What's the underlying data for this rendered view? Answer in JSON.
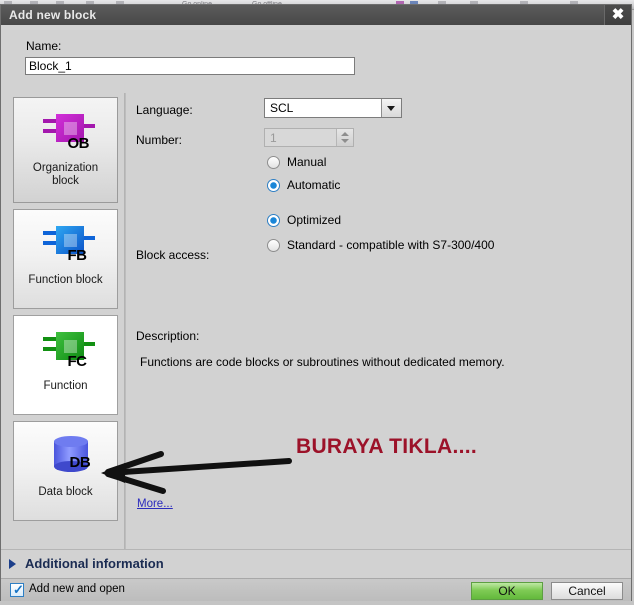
{
  "app_background": {
    "toolbar_hints": [
      "Go online",
      "Go offline"
    ]
  },
  "dialog": {
    "title": "Add new block",
    "close_icon": "close-icon",
    "name": {
      "label": "Name:",
      "value": "Block_1",
      "placeholder": "Block_1"
    },
    "block_types": [
      {
        "id": "ob",
        "label_line1": "Organization",
        "label_line2": "block",
        "glyph_text": "OB",
        "color": "#a318ad",
        "selected": true
      },
      {
        "id": "fb",
        "label_line1": "Function block",
        "label_line2": "",
        "glyph_text": "FB",
        "color": "#0e64d8",
        "selected": false
      },
      {
        "id": "fc",
        "label_line1": "Function",
        "label_line2": "",
        "glyph_text": "FC",
        "color": "#129012",
        "selected": false
      },
      {
        "id": "db",
        "label_line1": "Data block",
        "label_line2": "",
        "glyph_text": "DB",
        "color": "#4a55dd",
        "selected": false
      }
    ],
    "form": {
      "language_label": "Language:",
      "language_value": "SCL",
      "language_options": [
        "SCL"
      ],
      "number_label": "Number:",
      "number_value": "1",
      "number_enabled": false,
      "numbering_options": [
        {
          "label": "Manual",
          "checked": false
        },
        {
          "label": "Automatic",
          "checked": true
        }
      ],
      "block_access_label": "Block access:",
      "block_access_options": [
        {
          "label": "Optimized",
          "checked": true
        },
        {
          "label": "Standard - compatible with S7-300/400",
          "checked": false
        }
      ],
      "description_label": "Description:",
      "description_text": "Functions are code blocks or subroutines without dedicated memory.",
      "more_link": "More..."
    },
    "annotation": {
      "text": "BURAYA TIKLA....",
      "color": "#9c1229",
      "arrow": "hand-drawn arrow pointing left to Data block"
    },
    "additional_information": {
      "label": "Additional  information",
      "expanded": false
    },
    "footer": {
      "checkbox_label": "Add new and open",
      "checkbox_checked": true,
      "ok_label": "OK",
      "cancel_label": "Cancel",
      "ok_color": "#7fcb55"
    }
  }
}
